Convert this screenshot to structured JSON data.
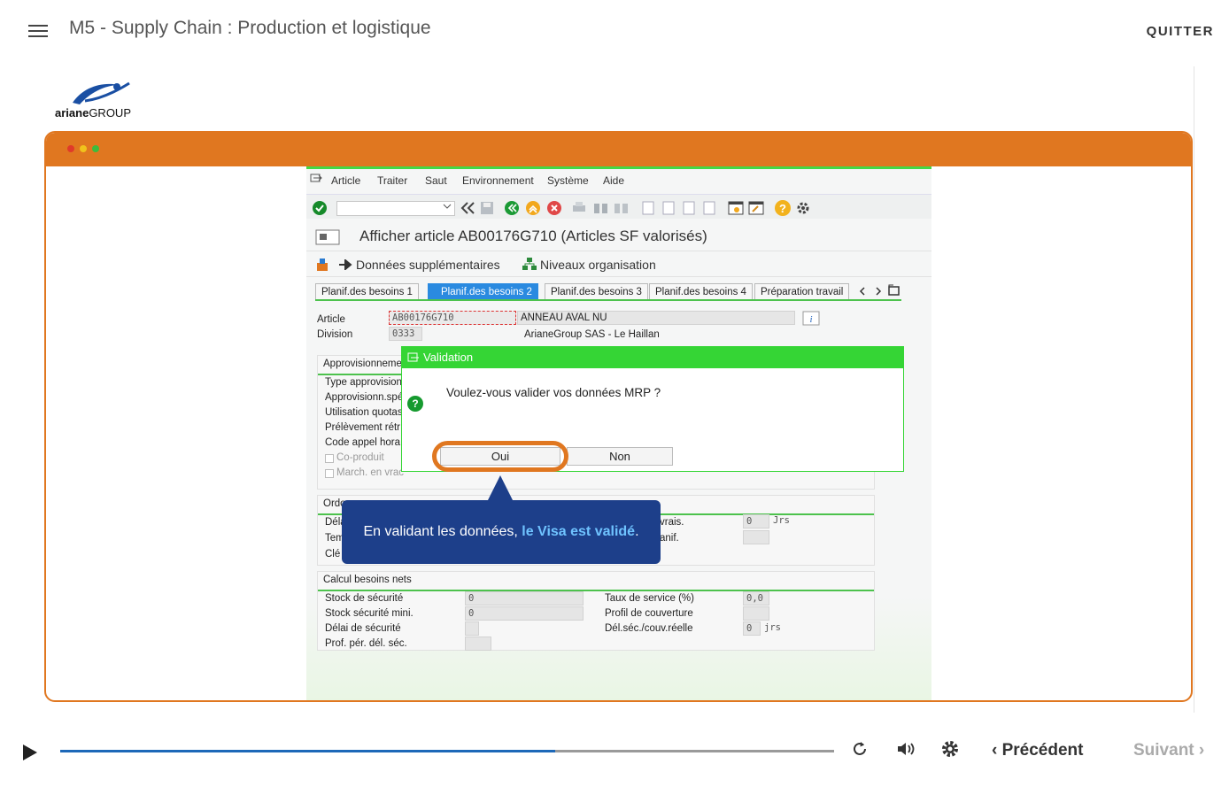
{
  "header": {
    "course_title": "M5 - Supply Chain : Production et logistique",
    "quit_label": "QUITTER"
  },
  "logo": {
    "bold": "ariane",
    "light": "GROUP"
  },
  "sap": {
    "menu": [
      "Article",
      "Traiter",
      "Saut",
      "Environnement",
      "Système",
      "Aide"
    ],
    "title": "Afficher article AB00176G710 (Articles SF valorisés)",
    "app_toolbar": {
      "more_data": "Données supplémentaires",
      "org_levels": "Niveaux organisation"
    },
    "tabs": [
      "Planif.des besoins 1",
      "Planif.des besoins 2",
      "Planif.des besoins 3",
      "Planif.des besoins 4",
      "Préparation travail"
    ],
    "active_tab": "Planif.des besoins 2",
    "fields": {
      "article_label": "Article",
      "article_value": "AB00176G710",
      "article_desc": "ANNEAU AVAL NU",
      "division_label": "Division",
      "division_value": "0333",
      "division_desc": "ArianeGroup SAS - Le Haillan"
    },
    "group_appro": {
      "title": "Approvisionneme",
      "rows": [
        "Type approvision",
        "Approvisionn.spé",
        "Utilisation quotas",
        "Prélèvement rétr",
        "Code appel hora"
      ],
      "checkboxes": [
        "Co-produit",
        "March. en vrac"
      ]
    },
    "group_ordo": {
      "title": "Ordo",
      "rows": [
        "Délai",
        "Tem",
        "Clé"
      ],
      "right_labels": [
        "vrais.",
        "anif."
      ],
      "right_values": [
        "0",
        ""
      ],
      "unit": "Jrs"
    },
    "group_calc": {
      "title": "Calcul besoins nets",
      "left_labels": [
        "Stock de sécurité",
        "Stock sécurité mini.",
        "Délai de sécurité",
        "Prof. pér. dél. séc."
      ],
      "left_values": [
        "0",
        "0",
        "",
        ""
      ],
      "right_labels": [
        "Taux de service (%)",
        "Profil de couverture",
        "Dél.séc./couv.réelle"
      ],
      "right_values": [
        "0,0",
        "",
        "0"
      ],
      "right_unit": "jrs"
    }
  },
  "dialog": {
    "title": "Validation",
    "question": "Voulez-vous valider vos données MRP ?",
    "yes_label": "Oui",
    "no_label": "Non"
  },
  "callout": {
    "text_before": "En validant les données, ",
    "text_highlight": "le Visa est validé",
    "text_after": "."
  },
  "player": {
    "progress": 0.64,
    "prev_label": "Précédent",
    "next_label": "Suivant"
  },
  "colors": {
    "accent": "#e07720",
    "sap_green": "#35d535",
    "callout_blue": "#1d3f8a",
    "progress_blue": "#1d68b8"
  }
}
